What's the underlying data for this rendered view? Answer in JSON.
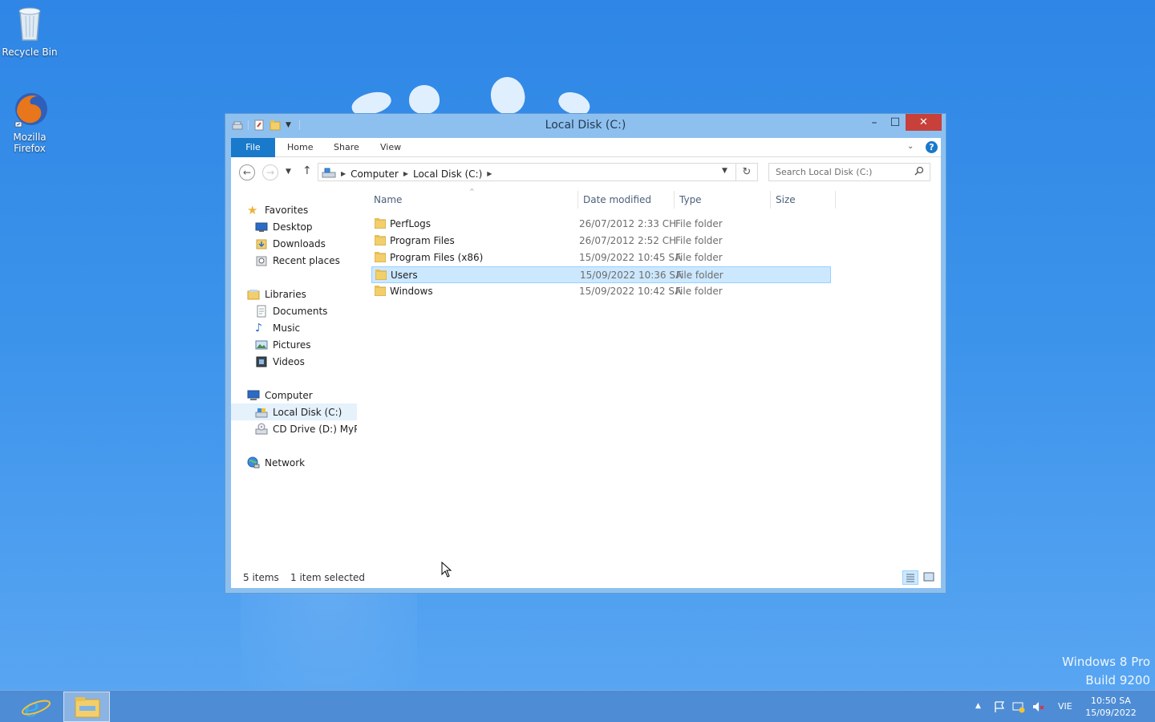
{
  "desktop": {
    "icons": [
      {
        "label": "Recycle Bin"
      },
      {
        "label": "Mozilla Firefox"
      }
    ],
    "watermark": {
      "line1": "Windows 8 Pro",
      "line2": "Build 9200"
    }
  },
  "window": {
    "title": "Local Disk (C:)",
    "buttons": {
      "minimize": "–",
      "maximize": "☐",
      "close": "✕"
    }
  },
  "ribbon": {
    "tabs": [
      "File",
      "Home",
      "Share",
      "View"
    ],
    "help": "?"
  },
  "navigation": {
    "breadcrumb": [
      "Computer",
      "Local Disk (C:)"
    ],
    "search_placeholder": "Search Local Disk (C:)"
  },
  "nav_pane": {
    "favorites": {
      "label": "Favorites",
      "items": [
        "Desktop",
        "Downloads",
        "Recent places"
      ]
    },
    "libraries": {
      "label": "Libraries",
      "items": [
        "Documents",
        "Music",
        "Pictures",
        "Videos"
      ]
    },
    "computer": {
      "label": "Computer",
      "items": [
        "Local Disk (C:)",
        "CD Drive (D:) MyPal"
      ]
    },
    "network": {
      "label": "Network"
    }
  },
  "file_list": {
    "columns": [
      "Name",
      "Date modified",
      "Type",
      "Size"
    ],
    "rows": [
      {
        "name": "PerfLogs",
        "date": "26/07/2012 2:33 CH",
        "type": "File folder",
        "size": "",
        "selected": false
      },
      {
        "name": "Program Files",
        "date": "26/07/2012 2:52 CH",
        "type": "File folder",
        "size": "",
        "selected": false
      },
      {
        "name": "Program Files (x86)",
        "date": "15/09/2022 10:45 SA",
        "type": "File folder",
        "size": "",
        "selected": false
      },
      {
        "name": "Users",
        "date": "15/09/2022 10:36 SA",
        "type": "File folder",
        "size": "",
        "selected": true
      },
      {
        "name": "Windows",
        "date": "15/09/2022 10:42 SA",
        "type": "File folder",
        "size": "",
        "selected": false
      }
    ]
  },
  "status": {
    "item_count": "5 items",
    "selection": "1 item selected"
  },
  "taskbar": {
    "language": "VIE",
    "time": "10:50 SA",
    "date": "15/09/2022"
  },
  "colors": {
    "accent": "#1979ca",
    "selection_bg": "#cce8ff",
    "selection_border": "#99d1ff",
    "close_button": "#c7403a"
  }
}
